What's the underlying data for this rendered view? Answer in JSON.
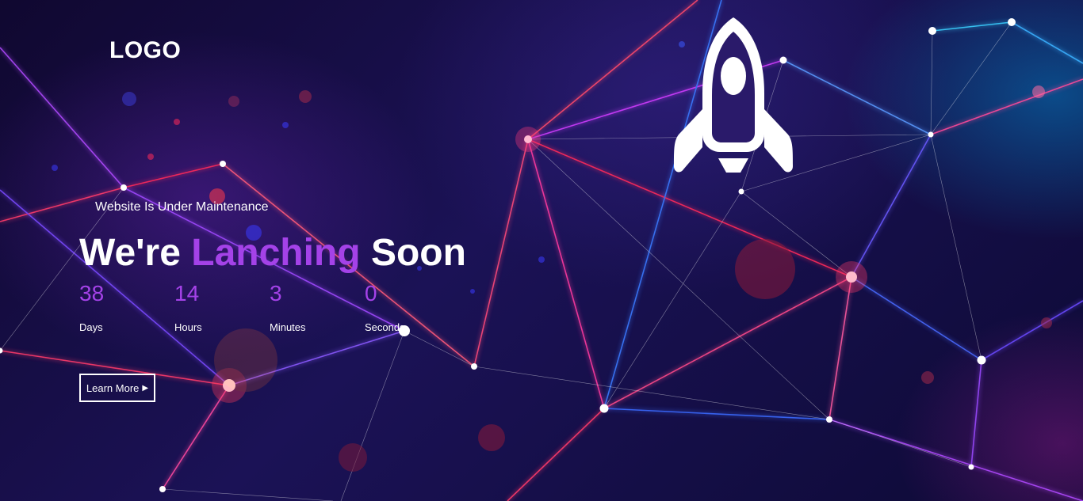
{
  "header": {
    "logo_text": "LOGO"
  },
  "hero": {
    "tagline": "Website Is Under Maintenance",
    "headline_part1": "We're",
    "headline_accent": "Lanching",
    "headline_part2": "Soon",
    "countdown": [
      {
        "value": "38",
        "label": "Days"
      },
      {
        "value": "14",
        "label": "Hours"
      },
      {
        "value": "3",
        "label": "Minutes"
      },
      {
        "value": "0",
        "label": "Seconds"
      }
    ],
    "button_label": "Learn More",
    "button_icon": "play-triangle-icon"
  },
  "colors": {
    "accent": "#a442e8",
    "text": "#ffffff",
    "background": "#1b1256"
  }
}
